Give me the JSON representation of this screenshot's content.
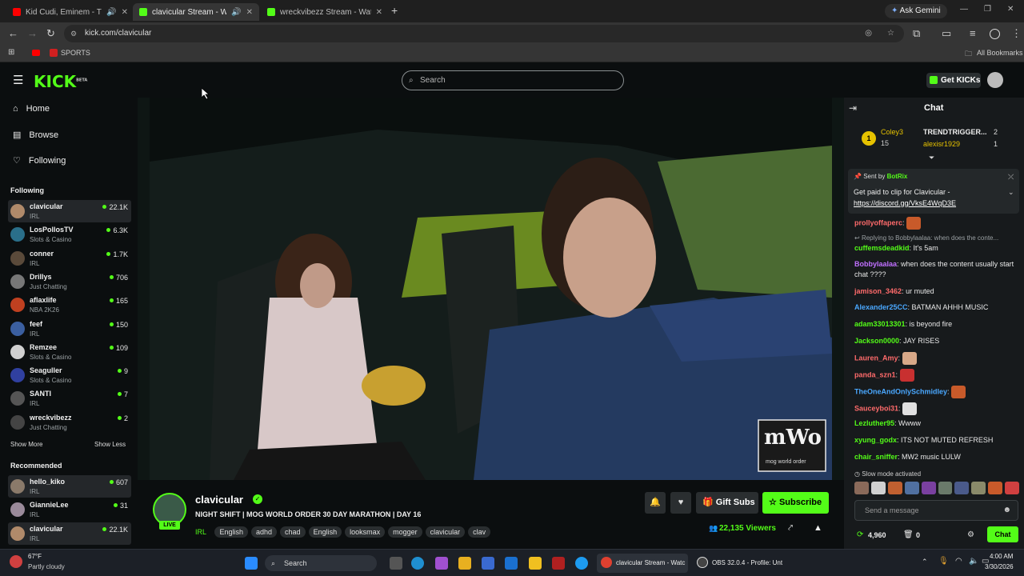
{
  "browser": {
    "tabs": [
      {
        "title": "Kid Cudi, Eminem - The Adv",
        "fav": "#ff0000"
      },
      {
        "title": "clavicular Stream - Watch Li",
        "fav": "#53fc18"
      },
      {
        "title": "wreckvibezz Stream - Watch Live",
        "fav": "#53fc18"
      }
    ],
    "ask_gemini": "Ask Gemini",
    "url": "kick.com/clavicular",
    "bookmark_sports": "SPORTS",
    "all_bookmarks": "All Bookmarks"
  },
  "header": {
    "logo": "KICK",
    "logo_sup": "BETA",
    "search_placeholder": "Search",
    "get_kicks": "Get KICKs"
  },
  "sidebar": {
    "nav": [
      {
        "label": "Home",
        "icon": "home-icon"
      },
      {
        "label": "Browse",
        "icon": "browse-icon"
      },
      {
        "label": "Following",
        "icon": "heart-icon"
      }
    ],
    "following_title": "Following",
    "following": [
      {
        "name": "clavicular",
        "category": "IRL",
        "viewers": "22.1K",
        "color": "#b08a6a"
      },
      {
        "name": "LosPollosTV",
        "category": "Slots & Casino",
        "viewers": "6.3K",
        "color": "#2a6f8a"
      },
      {
        "name": "conner",
        "category": "IRL",
        "viewers": "1.7K",
        "color": "#5a4a3a"
      },
      {
        "name": "Drillys",
        "category": "Just Chatting",
        "viewers": "706",
        "color": "#777777"
      },
      {
        "name": "aflaxlife",
        "category": "NBA 2K26",
        "viewers": "165",
        "color": "#c04020"
      },
      {
        "name": "feef",
        "category": "IRL",
        "viewers": "150",
        "color": "#3b5fa0"
      },
      {
        "name": "Remzee",
        "category": "Slots & Casino",
        "viewers": "109",
        "color": "#d0d0d0"
      },
      {
        "name": "Seaguller",
        "category": "Slots & Casino",
        "viewers": "9",
        "color": "#3040a0"
      },
      {
        "name": "SANTI",
        "category": "IRL",
        "viewers": "7",
        "color": "#555555"
      },
      {
        "name": "wreckvibezz",
        "category": "Just Chatting",
        "viewers": "2",
        "color": "#444444"
      }
    ],
    "show_more": "Show More",
    "show_less": "Show Less",
    "recommended_title": "Recommended",
    "recommended": [
      {
        "name": "hello_kiko",
        "category": "IRL",
        "viewers": "607",
        "color": "#8a7a6a"
      },
      {
        "name": "GiannieLee",
        "category": "IRL",
        "viewers": "31",
        "color": "#9a8a9a"
      },
      {
        "name": "clavicular",
        "category": "IRL",
        "viewers": "22.1K",
        "color": "#b08a6a"
      }
    ]
  },
  "video": {
    "watermark": "mWo",
    "watermark_sub": "mog world order"
  },
  "stream": {
    "channel": "clavicular",
    "live": "LIVE",
    "title": "NIGHT SHIFT | MOG WORLD ORDER 30 DAY MARATHON | DAY 16",
    "category": "IRL",
    "tags": [
      "English",
      "adhd",
      "chad",
      "English",
      "looksmax",
      "mogger",
      "clavicular",
      "clav"
    ],
    "gift_subs": "Gift Subs",
    "subscribe": "Subscribe",
    "viewers": "22,135 Viewers",
    "accent": "#53fc18"
  },
  "chat": {
    "title": "Chat",
    "leaderboard": [
      {
        "rank": "1",
        "name": "Coley3",
        "count": "15"
      },
      {
        "name": "TRENDTRIGGER...",
        "count": "2"
      },
      {
        "name": "alexisr1929",
        "count": "1"
      }
    ],
    "pinned_sent_by": "Sent by",
    "pinned_bot": "BotRix",
    "pinned_text": "Get paid to clip for Clavicular -",
    "pinned_link": "https://discord.gg/VksE4WqD3E",
    "messages": [
      {
        "user": "prollyoffaperc",
        "color": "#ff6b6b",
        "text": "",
        "emote": "#c85a2a"
      },
      {
        "reply": "Replying to Bobbylaalaa: when does the conte..."
      },
      {
        "user": "cuffemsdeadkid",
        "color": "#53fc18",
        "text": "It's 5am"
      },
      {
        "user": "Bobbylaalaa",
        "color": "#c070ff",
        "text": "when does the content usually start chat ????"
      },
      {
        "user": "jamison_3462",
        "color": "#ff6b6b",
        "text": "ur muted"
      },
      {
        "user": "Alexander25CC",
        "color": "#4aa8ff",
        "text": "BATMAN AHHH MUSIC"
      },
      {
        "user": "adam33013301",
        "color": "#53fc18",
        "text": "is beyond fire"
      },
      {
        "user": "Jackson0000",
        "color": "#53fc18",
        "text": "JAY RISES"
      },
      {
        "user": "Lauren_Amy",
        "color": "#ff6b6b",
        "text": "",
        "emote": "#d8a888"
      },
      {
        "user": "panda_szn1",
        "color": "#ff6b6b",
        "text": "",
        "emote": "#c83030"
      },
      {
        "user": "TheOneAndOnlySchmidley",
        "color": "#4aa8ff",
        "text": "",
        "emote": "#c85a2a"
      },
      {
        "user": "Sauceyboi31",
        "color": "#ff6b6b",
        "text": "",
        "emote": "#e0e0e0"
      },
      {
        "user": "Lezluther95",
        "color": "#53fc18",
        "text": "Wwww"
      },
      {
        "user": "xyung_godx",
        "color": "#53fc18",
        "text": "ITS NOT MUTED REFRESH"
      },
      {
        "user": "chair_sniffer",
        "color": "#53fc18",
        "text": "MW2 music LULW"
      }
    ],
    "slow_mode": "Slow mode activated",
    "send_placeholder": "Send a message",
    "points": "4,960",
    "gifts": "0",
    "chat_button": "Chat"
  },
  "taskbar": {
    "weather_temp": "67°F",
    "weather_desc": "Partly cloudy",
    "search": "Search",
    "app1": "clavicular Stream - Watc",
    "app2": "OBS 32.0.4 - Profile: Unt",
    "time": "4:00 AM",
    "date": "3/30/2026"
  }
}
